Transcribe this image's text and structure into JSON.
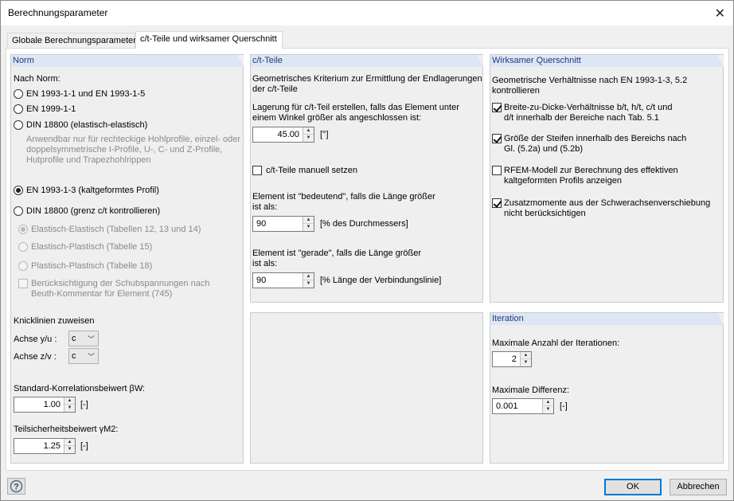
{
  "window": {
    "title": "Berechnungsparameter"
  },
  "tabs": [
    "Globale Berechnungsparameter",
    "c/t-Teile und wirksamer Querschnitt"
  ],
  "norm": {
    "header": "Norm",
    "nach_norm": "Nach Norm:",
    "options": [
      "EN 1993-1-1 und EN 1993-1-5",
      "EN 1999-1-1",
      "DIN 18800 (elastisch-elastisch)"
    ],
    "din_note_1": "Anwendbar nur für rechteckige Hohlprofile, einzel- oder",
    "din_note_2": "doppelsymmetrische I-Profile, U-, C- und Z-Profile,",
    "din_note_3": "Hutprofile und Trapezhohlrippen",
    "option_cold": "EN 1993-1-3 (kaltgeformtes Profil)",
    "option_din_grenz": "DIN 18800 (grenz c/t kontrollieren)",
    "sub_options": [
      "Elastisch-Elastisch (Tabellen 12, 13 und 14)",
      "Elastisch-Plastisch (Tabelle 15)",
      "Plastisch-Plastisch (Tabelle 18)"
    ],
    "shear_1": "Berücksichtigung der Schubspannungen nach",
    "shear_2": "Beuth-Kommentar für Element (745)",
    "knick_title": "Knicklinien zuweisen",
    "achse_yu": "Achse y/u :",
    "achse_yu_val": "c",
    "achse_zv": "Achse z/v :",
    "achse_zv_val": "c",
    "beta_label": "Standard-Korrelationsbeiwert βW:",
    "beta_val": "1.00",
    "beta_unit": "[-]",
    "gamma_label": "Teilsicherheitsbeiwert γM2:",
    "gamma_val": "1.25",
    "gamma_unit": "[-]"
  },
  "ct": {
    "header": "c/t-Teile",
    "crit_1": "Geometrisches Kriterium zur Ermittlung der Endlagerungen",
    "crit_2": "der c/t-Teile",
    "lager_1": "Lagerung für c/t-Teil erstellen, falls das Element unter",
    "lager_2": "einem Winkel größer als angeschlossen ist:",
    "angle_val": "45.00",
    "angle_unit": "[°]",
    "manual": "c/t-Teile manuell setzen",
    "bed_1": "Element ist \"bedeutend\", falls die Länge größer",
    "bed_2": "ist als:",
    "bed_val": "90",
    "bed_unit": "[% des Durchmessers]",
    "ger_1": "Element ist \"gerade\", falls die Länge größer",
    "ger_2": "ist als:",
    "ger_val": "90",
    "ger_unit": "[% Länge der Verbindungslinie]"
  },
  "wq": {
    "header": "Wirksamer Querschnitt",
    "geo_1": "Geometrische Verhältnisse nach EN 1993-1-3, 5.2",
    "geo_2": "kontrollieren",
    "c1_1": "Breite-zu-Dicke-Verhältnisse b/t, h/t, c/t und",
    "c1_2": "d/t innerhalb der Bereiche nach Tab. 5.1",
    "c2_1": "Größe der Steifen innerhalb des Bereichs nach",
    "c2_2": "Gl. (5.2a) und (5.2b)",
    "c3_1": "RFEM-Modell zur Berechnung des effektiven",
    "c3_2": "kaltgeformten Profils anzeigen",
    "c4_1": "Zusatzmomente aus der Schwerachsenverschiebung",
    "c4_2": "nicht berücksichtigen"
  },
  "iter": {
    "header": "Iteration",
    "max_iter_label": "Maximale Anzahl der Iterationen:",
    "max_iter_val": "2",
    "max_diff_label": "Maximale Differenz:",
    "max_diff_val": "0.001",
    "max_diff_unit": "[-]"
  },
  "footer": {
    "ok": "OK",
    "cancel": "Abbrechen"
  }
}
